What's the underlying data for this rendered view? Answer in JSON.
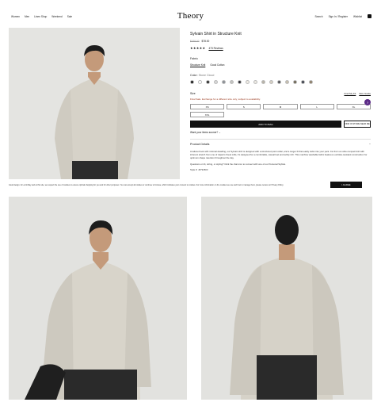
{
  "header": {
    "nav": [
      "Women",
      "Men",
      "Linen Shop",
      "Weekend",
      "Sale"
    ],
    "logo": "Theory",
    "utils": {
      "search": "Search",
      "account": "Sign In / Register",
      "wishlist": "Wishlist"
    }
  },
  "product": {
    "title": "Sylvain Shirt in Structure Knit",
    "price_old": "$195.00",
    "price_new": "$78.00",
    "stars": "★★★★★",
    "reviews": "473 Reviews",
    "fabric_label": "Fabric",
    "fabrics": [
      "Structure Knit",
      "Good Cotton"
    ],
    "color_label": "Color:",
    "color_value": "Stone Cloud",
    "size_label": "Size",
    "size_links": [
      "Find My Fit",
      "Size Guide"
    ],
    "final_sale": "Final Sale. Exchange for a different size only, subject to availability.",
    "sizes_row1": [
      "XS",
      "S",
      "M",
      "L",
      "XL"
    ],
    "sizes_row2": [
      "XXL"
    ],
    "add_to_bag": "ADD TO BAG",
    "find_in_store": "FIND IN STORE NEAR ME",
    "wear": "Want your items sooner?",
    "details_label": "Product Details",
    "details_toggle": "−",
    "description": "A tailored look with minimal detailing, our Sylvain shirt is designed with a structured point collar, and a longer fit that easily tucks into your pant. Cut from an ultra compact knit with inherent stretch from one of Japan's finest mills, it's designed for a comfortable, casual feel and subtly rich. This machine washable fabric features a wrinkle-resistant construction for optimum shape retention throughout the day.",
    "questions": "Questions on fit, sizing, or styling? Click the chat icon to connect with one of our Personal Stylists.",
    "style": "Style #: J0794503"
  },
  "swatch_colors": [
    "#1a1a1a",
    "#ffffff",
    "#2b2b2b",
    "#d8d8d8",
    "#8a8f96",
    "#c4c4c0",
    "#2d2d33",
    "#f0ede6",
    "#ece9e2",
    "#b8b3a7",
    "#d7d1c4",
    "#505055",
    "#c7bfae",
    "#6c6552",
    "#3b3f4a",
    "#8d7e66"
  ],
  "chat_glyph": "?",
  "cookie": {
    "text": "Good design. At Lumli Ray and at this site, we respect the use of cookies to ensure optimal shopping for you and for other purposes. You can accept all cookies or continue to browse, which indicates your consent to cookies. For more information on the cookies we use and how to manage them, please review our Privacy Policy.",
    "button": "I AGREE"
  },
  "colors": {
    "accent": "#111111",
    "sale": "#9b3a1f",
    "chat": "#5b2a86"
  }
}
